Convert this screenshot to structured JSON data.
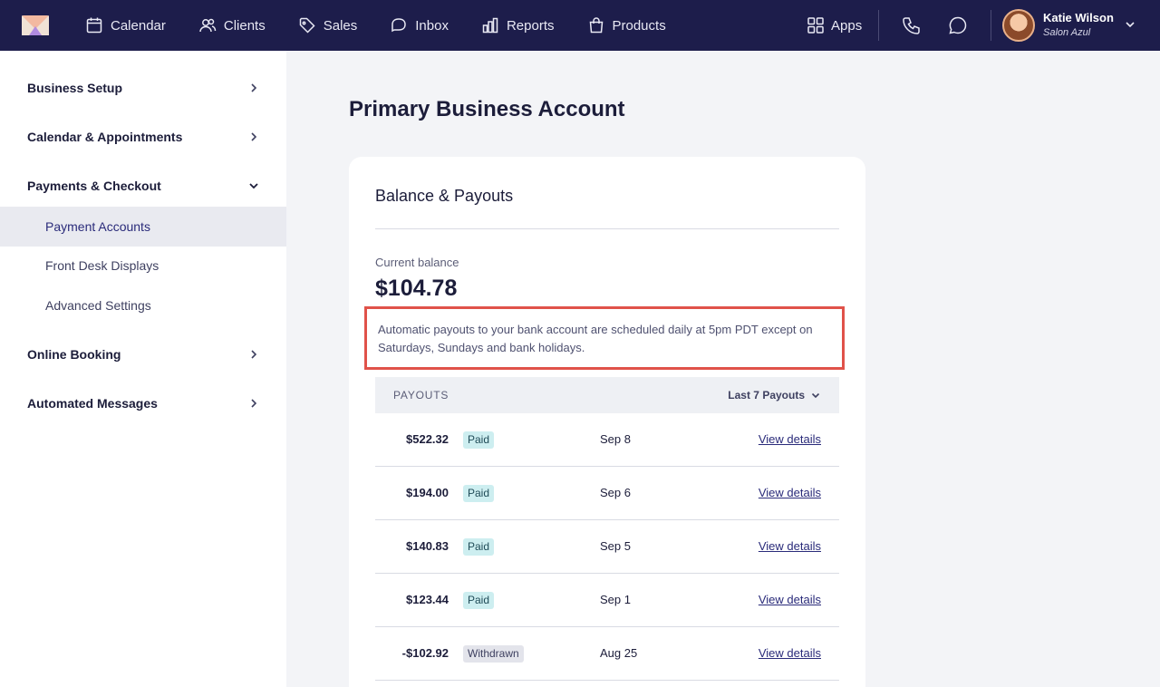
{
  "nav": {
    "logo": "mangomint-logo",
    "items": [
      {
        "label": "Calendar",
        "icon": "calendar-icon"
      },
      {
        "label": "Clients",
        "icon": "users-icon"
      },
      {
        "label": "Sales",
        "icon": "tag-icon"
      },
      {
        "label": "Inbox",
        "icon": "inbox-icon"
      },
      {
        "label": "Reports",
        "icon": "bar-chart-icon"
      },
      {
        "label": "Products",
        "icon": "shopping-bag-icon"
      }
    ],
    "apps_label": "Apps",
    "user": {
      "name": "Katie Wilson",
      "salon": "Salon Azul"
    }
  },
  "sidebar": {
    "groups": [
      {
        "label": "Business Setup",
        "expanded": false
      },
      {
        "label": "Calendar & Appointments",
        "expanded": false
      },
      {
        "label": "Payments & Checkout",
        "expanded": true
      },
      {
        "label": "Online Booking",
        "expanded": false
      },
      {
        "label": "Automated Messages",
        "expanded": false
      }
    ],
    "sub_items": [
      {
        "label": "Payment Accounts",
        "active": true
      },
      {
        "label": "Front Desk Displays",
        "active": false
      },
      {
        "label": "Advanced Settings",
        "active": false
      }
    ]
  },
  "main": {
    "title": "Primary Business Account",
    "card": {
      "title": "Balance & Payouts",
      "balance_label": "Current balance",
      "balance_value": "$104.78",
      "notice": "Automatic payouts to your bank account are scheduled daily at 5pm PDT except on Saturdays, Sundays and bank holidays.",
      "table": {
        "header": "PAYOUTS",
        "filter": "Last 7 Payouts",
        "rows": [
          {
            "amount": "$522.32",
            "status": "Paid",
            "date": "Sep 8",
            "link": "View details"
          },
          {
            "amount": "$194.00",
            "status": "Paid",
            "date": "Sep 6",
            "link": "View details"
          },
          {
            "amount": "$140.83",
            "status": "Paid",
            "date": "Sep 5",
            "link": "View details"
          },
          {
            "amount": "$123.44",
            "status": "Paid",
            "date": "Sep 1",
            "link": "View details"
          },
          {
            "amount": "-$102.92",
            "status": "Withdrawn",
            "date": "Aug 25",
            "link": "View details"
          }
        ]
      }
    }
  },
  "colors": {
    "nav_bg": "#1d1d4b",
    "page_bg": "#f3f4f7",
    "accent": "#2a2b7a",
    "highlight_border": "#e0524a",
    "paid_badge": "#cdeef0",
    "withdrawn_badge": "#e3e4eb"
  }
}
